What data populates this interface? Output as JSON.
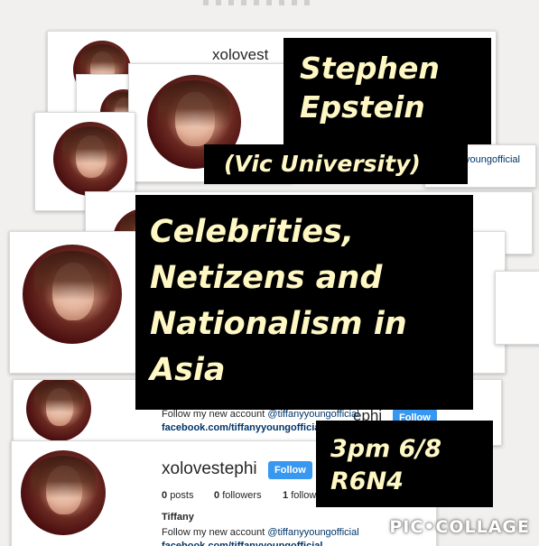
{
  "profile": {
    "username": "xolovestephi",
    "follow_label": "Follow",
    "posts_count": "0",
    "posts_label": "posts",
    "followers_count": "0",
    "followers_label": "followers",
    "following_count": "1",
    "following_label": "follow",
    "bio_name": "Tiffany",
    "bio_line": "Follow my new account",
    "bio_handle": "@tiffanyyoungofficial",
    "bio_link": "facebook.com/tiffanyyoungofficial",
    "partial_username": "xolovest",
    "partial_username_tail": "ephi",
    "partial_handle": "youngofficial"
  },
  "captions": {
    "speaker_line1": "Stephen",
    "speaker_line2": "Epstein",
    "affiliation": "(Vic University)",
    "title_line1": "Celebrities,",
    "title_line2": "Netizens and",
    "title_line3": "Nationalism in",
    "title_line4": "Asia",
    "time": "3pm 6/8",
    "room": "R6N4"
  },
  "watermark": "PIC•COLLAGE",
  "colors": {
    "caption_bg": "#000000",
    "caption_text": "#fff8c4",
    "follow_button": "#3897f0",
    "link": "#003569"
  }
}
